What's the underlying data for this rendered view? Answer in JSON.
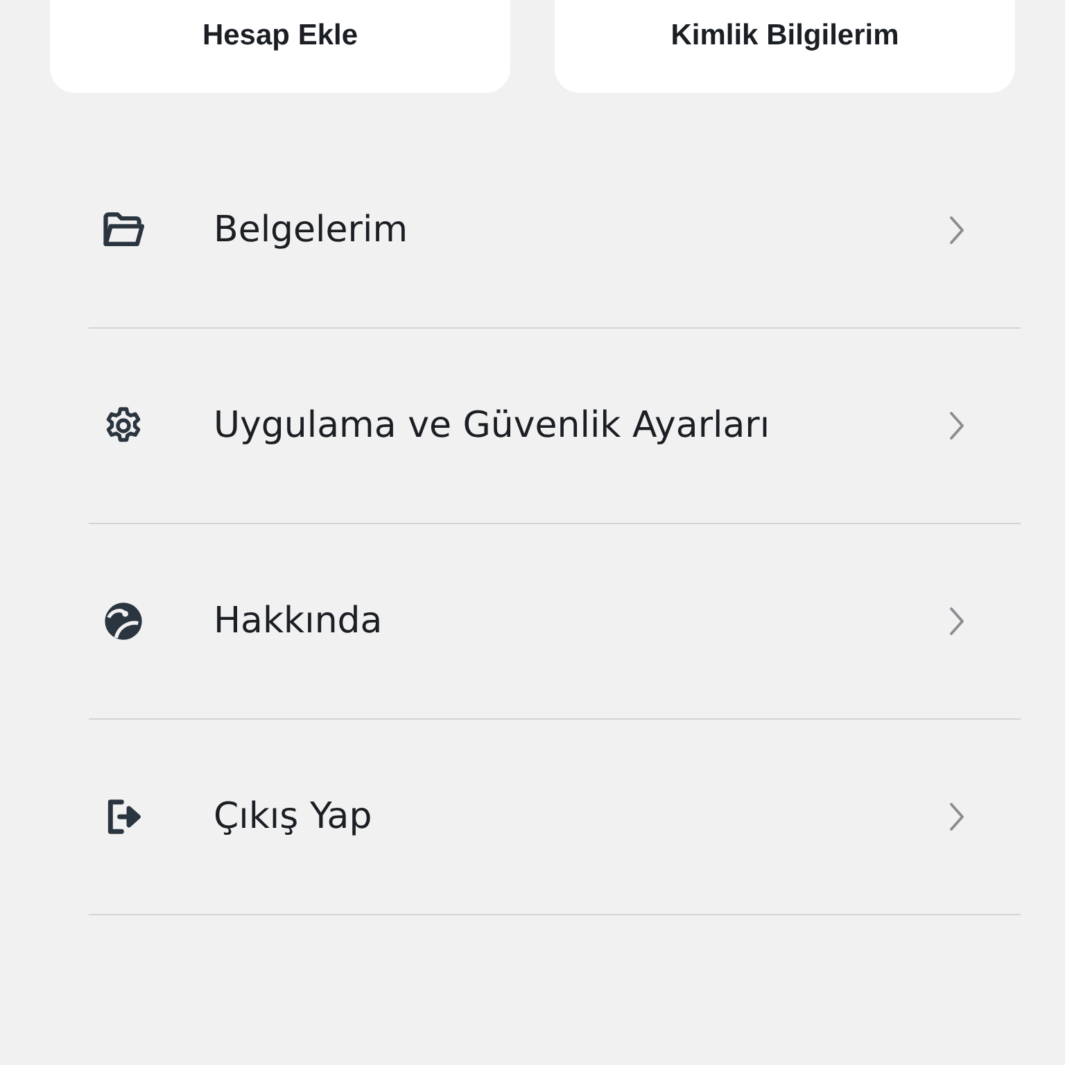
{
  "cards": [
    {
      "label": "Hesap Ekle"
    },
    {
      "label": "Kimlik Bilgilerim"
    }
  ],
  "menu": [
    {
      "label": "Belgelerim"
    },
    {
      "label": "Uygulama ve Güvenlik Ayarları"
    },
    {
      "label": "Hakkında"
    },
    {
      "label": "Çıkış Yap"
    }
  ]
}
